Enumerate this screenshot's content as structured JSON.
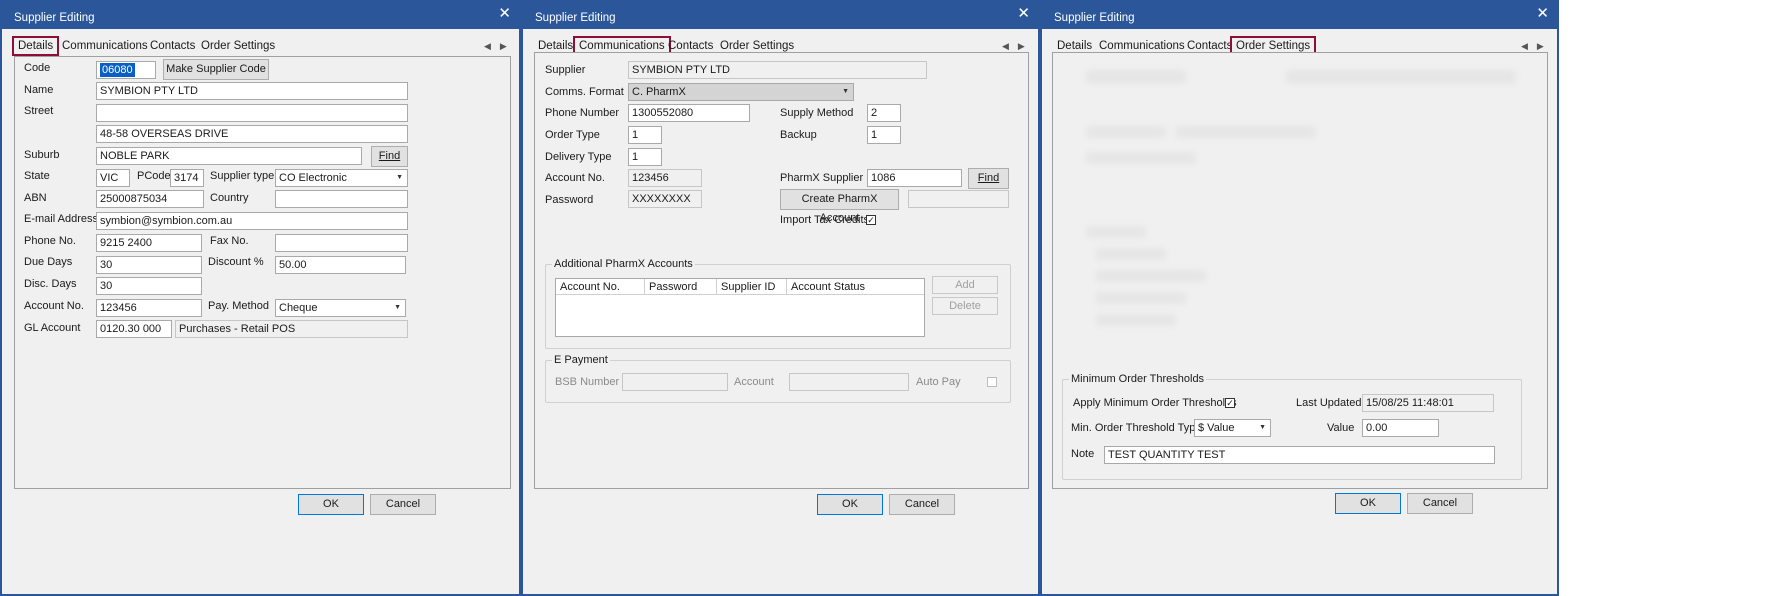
{
  "colors": {
    "titlebar": "#2b579a",
    "highlight": "#8b0e3b",
    "body": "#f0f0f0"
  },
  "dialog_title": "Supplier Editing",
  "tabs": [
    "Details",
    "Communications",
    "Contacts",
    "Order Settings"
  ],
  "buttons": {
    "ok": "OK",
    "cancel": "Cancel"
  },
  "details": {
    "code_label": "Code",
    "code_value": "06080",
    "make_supplier_code": "Make Supplier Code",
    "name_label": "Name",
    "name_value": "SYMBION PTY LTD",
    "street_label": "Street",
    "street_line1": "",
    "street_line2": "48-58 OVERSEAS DRIVE",
    "suburb_label": "Suburb",
    "suburb_value": "NOBLE PARK",
    "find_label": "Find",
    "state_label": "State",
    "state_value": "VIC",
    "pcode_label": "PCode",
    "pcode_value": "3174",
    "supplier_type_label": "Supplier type",
    "supplier_type_value": "CO  Electronic",
    "abn_label": "ABN",
    "abn_value": "25000875034",
    "country_label": "Country",
    "country_value": "",
    "email_label": "E-mail Address",
    "email_value": "symbion@symbion.com.au",
    "phone_label": "Phone No.",
    "phone_value": "9215 2400",
    "fax_label": "Fax No.",
    "fax_value": "",
    "due_days_label": "Due Days",
    "due_days_value": "30",
    "discount_label": "Discount %",
    "discount_value": "50.00",
    "disc_days_label": "Disc. Days",
    "disc_days_value": "30",
    "account_label": "Account No.",
    "account_value": "123456",
    "pay_method_label": "Pay. Method",
    "pay_method_value": "Cheque",
    "gl_label": "GL Account",
    "gl_code": "0120.30 000",
    "gl_desc": "Purchases - Retail POS"
  },
  "communications": {
    "supplier_label": "Supplier",
    "supplier_value": "SYMBION PTY LTD",
    "comms_format_label": "Comms. Format",
    "comms_format_value": "C. PharmX",
    "phone_label": "Phone Number",
    "phone_value": "1300552080",
    "supply_method_label": "Supply Method",
    "supply_method_value": "2",
    "order_type_label": "Order Type",
    "order_type_value": "1",
    "backup_label": "Backup",
    "backup_value": "1",
    "delivery_type_label": "Delivery Type",
    "delivery_type_value": "1",
    "account_label": "Account No.",
    "account_value": "123456",
    "pharmx_id_label": "PharmX Supplier ID",
    "pharmx_id_value": "1086",
    "find_label": "Find",
    "password_label": "Password",
    "password_value": "XXXXXXXX",
    "create_pharmx": "Create PharmX Account",
    "import_tax_label": "Import Tax Credits",
    "import_tax_checked": "✓",
    "additional_group": "Additional PharmX Accounts",
    "grid_columns": [
      "Account No.",
      "Password",
      "Supplier ID",
      "Account Status"
    ],
    "add_label": "Add",
    "delete_label": "Delete",
    "epayment_group": "E Payment",
    "bsb_label": "BSB Number",
    "epay_account_label": "Account",
    "auto_pay_label": "Auto Pay"
  },
  "order_settings": {
    "group_label": "Minimum Order Thresholds",
    "apply_label": "Apply Minimum Order Thresholds",
    "apply_checked": "✓",
    "last_updated_label": "Last Updated",
    "last_updated_value": "15/08/25 11:48:01",
    "threshold_type_label": "Min. Order Threshold Type",
    "threshold_type_value": "$ Value",
    "value_label": "Value",
    "value_value": "0.00",
    "note_label": "Note",
    "note_value": "TEST QUANTITY TEST"
  }
}
